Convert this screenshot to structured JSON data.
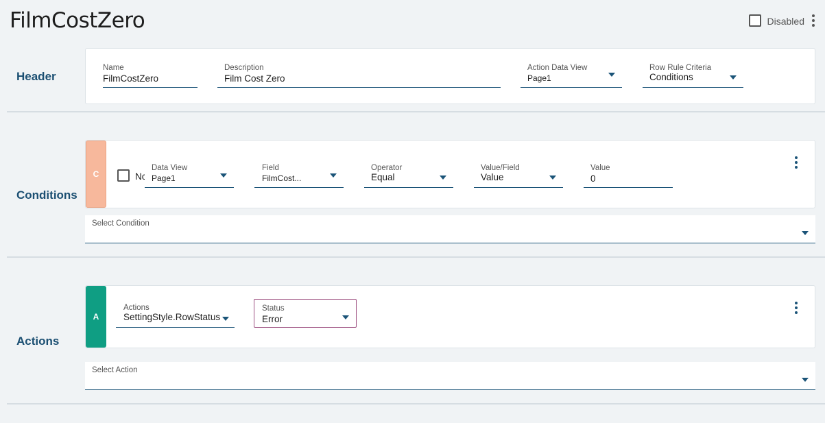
{
  "page": {
    "title": "FilmCostZero",
    "disabled_label": "Disabled"
  },
  "header": {
    "section_label": "Header",
    "name": {
      "label": "Name",
      "value": "FilmCostZero"
    },
    "description": {
      "label": "Description",
      "value": "Film Cost Zero"
    },
    "action_data_view": {
      "label": "Action Data View",
      "value": "Page1"
    },
    "row_rule_criteria": {
      "label": "Row Rule Criteria",
      "value": "Conditions"
    }
  },
  "conditions": {
    "section_label": "Conditions",
    "badge": "C",
    "badge_color": "#f7b89c",
    "not_label": "Nc",
    "data_view": {
      "label": "Data View",
      "value": "Page1"
    },
    "field": {
      "label": "Field",
      "value": "FilmCost..."
    },
    "operator": {
      "label": "Operator",
      "value": "Equal"
    },
    "value_field": {
      "label": "Value/Field",
      "value": "Value"
    },
    "value": {
      "label": "Value",
      "value": "0"
    },
    "select_label": "Select Condition"
  },
  "actions": {
    "section_label": "Actions",
    "badge": "A",
    "badge_color": "#0f9e83",
    "action": {
      "label": "Actions",
      "value": "SettingStyle.RowStatus"
    },
    "status": {
      "label": "Status",
      "value": "Error"
    },
    "select_label": "Select Action"
  },
  "icons": {
    "page_menu": "kebab-icon",
    "dropdown": "caret-down-icon"
  },
  "colors": {
    "accent": "#1b5478",
    "section_label": "#1b4f72",
    "status_border": "#9c4e7f"
  }
}
